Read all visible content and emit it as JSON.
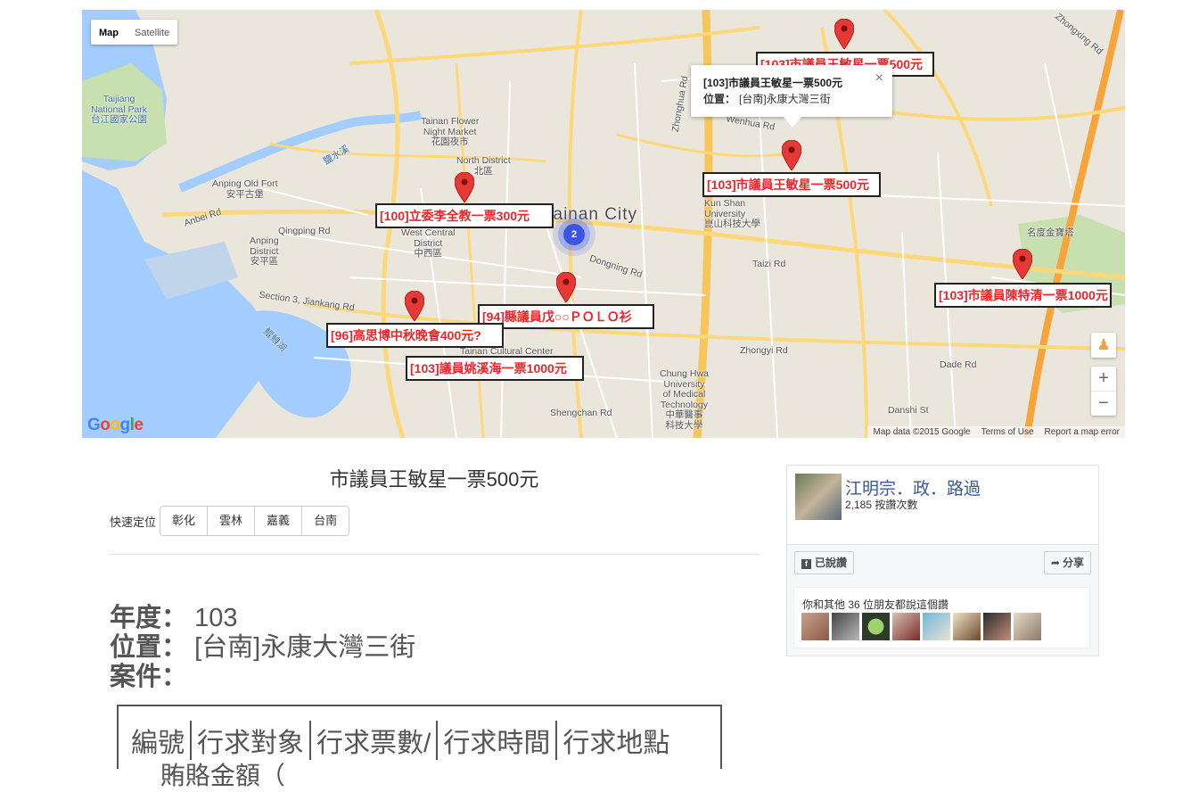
{
  "map": {
    "type_buttons": [
      "Map",
      "Satellite"
    ],
    "labels": [
      {
        "text": "Tainan City",
        "cls": "city"
      },
      {
        "text": "North District\n北區",
        "cls": ""
      },
      {
        "text": "West Central\nDistrict\n中西區",
        "cls": ""
      },
      {
        "text": "Anping\nDistrict\n安平區",
        "cls": ""
      },
      {
        "text": "Anping Old Fort\n安平古堡",
        "cls": ""
      },
      {
        "text": "Tainan Flower\nNight Market\n花園夜市",
        "cls": ""
      },
      {
        "text": "Taijiang\nNational Park\n台江國家公園",
        "cls": "water"
      },
      {
        "text": "Kun Shan\nUniversity\n崑山科技大學",
        "cls": ""
      },
      {
        "text": "Chung Hwa\nUniversity\nof Medical\nTechnology\n中華醫事\n科技大學",
        "cls": ""
      },
      {
        "text": "Tainan Cultural Center",
        "cls": ""
      },
      {
        "text": "Zhonghua Rd",
        "cls": ""
      },
      {
        "text": "Dongning Rd",
        "cls": ""
      },
      {
        "text": "Taizi Rd",
        "cls": ""
      },
      {
        "text": "Zhongyi Rd",
        "cls": ""
      },
      {
        "text": "Dade Rd",
        "cls": ""
      },
      {
        "text": "Danshi St",
        "cls": ""
      },
      {
        "text": "Shengchan Rd",
        "cls": ""
      },
      {
        "text": "Qingping Rd",
        "cls": ""
      },
      {
        "text": "Anbei Rd",
        "cls": ""
      },
      {
        "text": "Section 3, Jiankang Rd",
        "cls": ""
      },
      {
        "text": "名度金寶塔",
        "cls": ""
      },
      {
        "text": "Wenhua Rd",
        "cls": ""
      },
      {
        "text": "Zhongxing Rd",
        "cls": ""
      },
      {
        "text": "鹽水溪",
        "cls": "water"
      },
      {
        "text": "鯤鯓湖",
        "cls": "water"
      }
    ],
    "markers": [
      {
        "label": "[100]立委李全教一票300元"
      },
      {
        "label": "[94]縣議員戊○○ＰＯＬＯ衫"
      },
      {
        "label": "[96]高思博中秋晚會400元?"
      },
      {
        "label": "[103]議員姚溪海一票1000元"
      },
      {
        "label": "[103]市議員王敏星一票500元"
      },
      {
        "label": "[103]市議員王敏星一票500元"
      },
      {
        "label": "[103]市議員陳特清一票1000元"
      }
    ],
    "cluster_count": "2",
    "info_window": {
      "title": "[103]市議員王敏星一票500元",
      "location_label": "位置：",
      "location_value": "[台南]永康大灣三街",
      "close": "×"
    },
    "zoom_in": "+",
    "zoom_out": "−",
    "pegman_icon": "pegman-icon",
    "attribution": [
      "Map data ©2015 Google",
      "Terms of Use",
      "Report a map error"
    ],
    "logo_letters": [
      "G",
      "o",
      "o",
      "g",
      "l",
      "e"
    ],
    "logo_colors": [
      "#4285f4",
      "#ea4335",
      "#fbbc05",
      "#4285f4",
      "#34a853",
      "#ea4335"
    ]
  },
  "content": {
    "title": "市議員王敏星一票500元",
    "quick_label": "快速定位",
    "quick_buttons": [
      "彰化",
      "雲林",
      "嘉義",
      "台南"
    ],
    "year_label": "年度：",
    "year_value": "103",
    "location_label": "位置：",
    "location_value": "[台南]永康大灣三街",
    "case_label": "案件：",
    "table_headers": [
      "編號",
      "行求對象",
      "行求票數/",
      "行求時間",
      "行求地點"
    ],
    "table_row2": "賄賂金額（"
  },
  "facebook": {
    "page_name": "江明宗．政．路過",
    "likes": "2,185 按讚次數",
    "liked_button": "已說讚",
    "share_button": "分享",
    "friends_text": "你和其他 36 位朋友都說這個讚",
    "colors": {
      "link": "#3b5998"
    }
  }
}
